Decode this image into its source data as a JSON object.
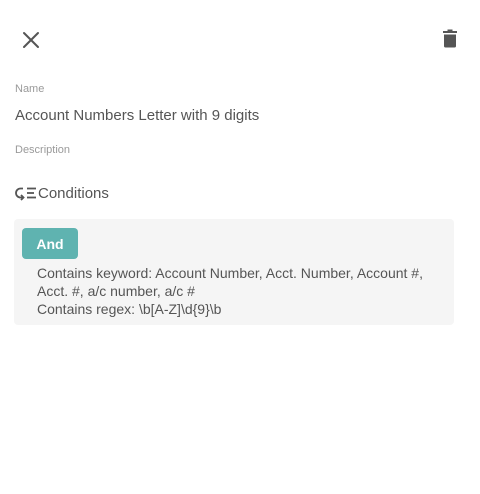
{
  "toolbar": {
    "close_icon": "close-icon",
    "delete_icon": "trash-icon"
  },
  "form": {
    "name_label": "Name",
    "name_value": "Account Numbers Letter with 9 digits",
    "description_label": "Description"
  },
  "conditions": {
    "heading": "Conditions",
    "heading_icon": "conditions-icon",
    "operator": "And",
    "rules": [
      "Contains keyword: Account Number, Acct. Number, Account #, Acct. #, a/c number, a/c #",
      "Contains regex: \\b[A-Z]\\d{9}\\b"
    ]
  },
  "colors": {
    "accent": "#5fb3b0",
    "text": "#555555",
    "label": "#9a9a9a",
    "box_bg": "#f5f5f5",
    "icon": "#555555"
  }
}
